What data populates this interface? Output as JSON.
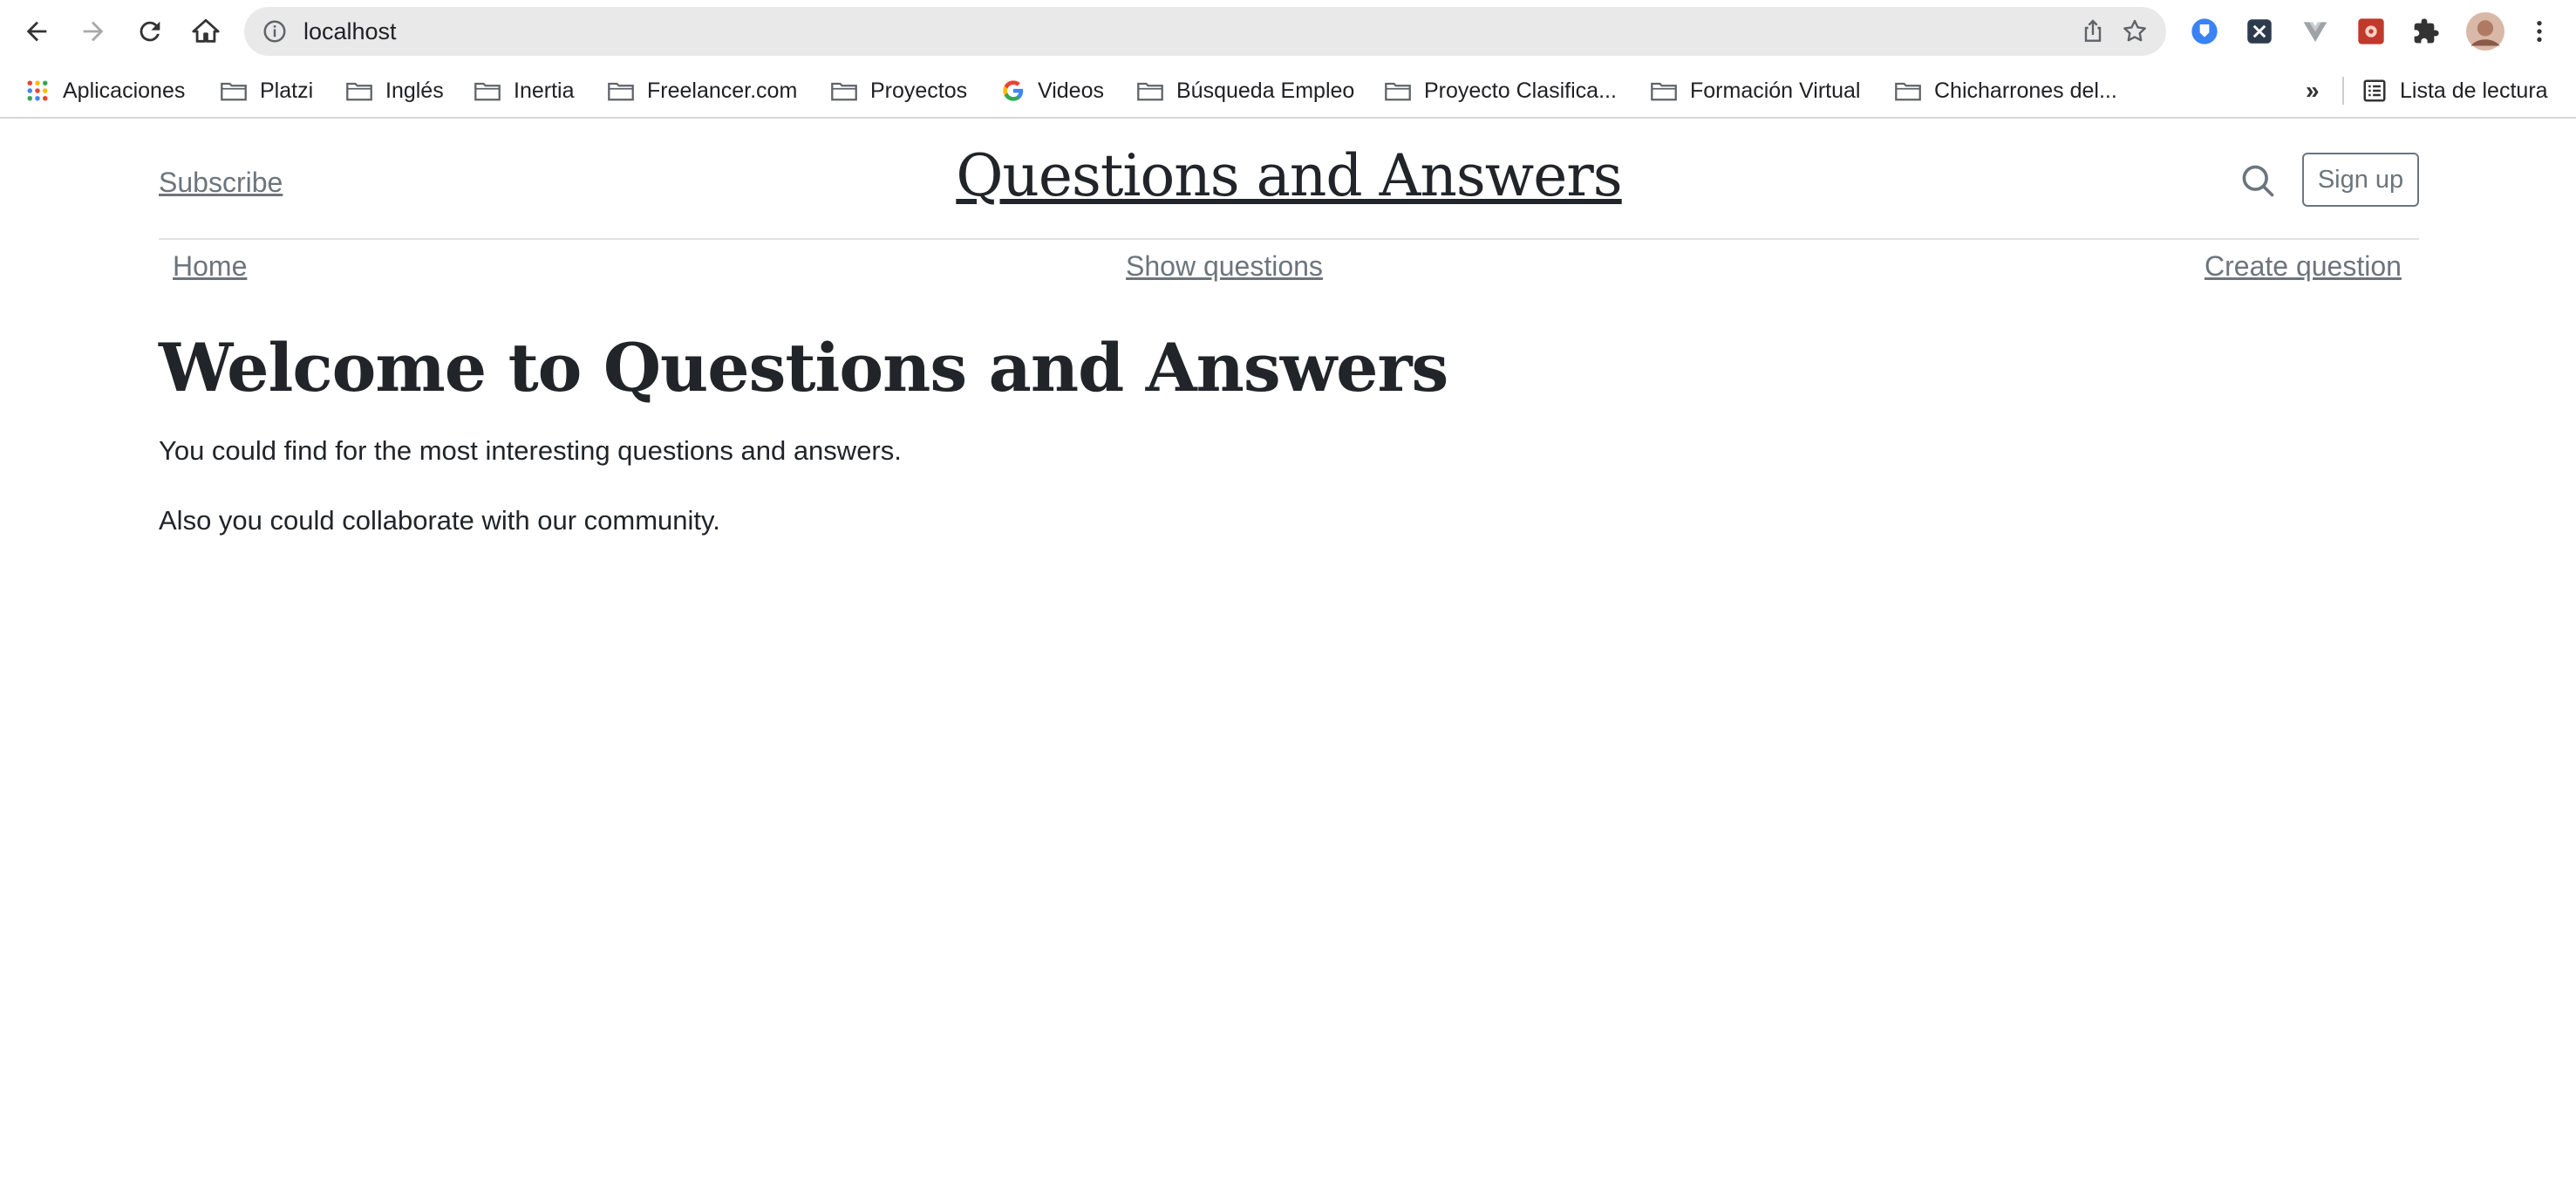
{
  "browser": {
    "url": "localhost",
    "bookmarks": [
      {
        "label": "Aplicaciones",
        "icon": "apps-grid-icon"
      },
      {
        "label": "Platzi",
        "icon": "folder-icon"
      },
      {
        "label": "Inglés",
        "icon": "folder-icon"
      },
      {
        "label": "Inertia",
        "icon": "folder-icon"
      },
      {
        "label": "Freelancer.com",
        "icon": "folder-icon"
      },
      {
        "label": "Proyectos",
        "icon": "folder-icon"
      },
      {
        "label": "Videos",
        "icon": "google-icon"
      },
      {
        "label": "Búsqueda Empleo",
        "icon": "folder-icon"
      },
      {
        "label": "Proyecto Clasifica...",
        "icon": "folder-icon"
      },
      {
        "label": "Formación Virtual",
        "icon": "folder-icon"
      },
      {
        "label": "Chicharrones del...",
        "icon": "folder-icon"
      }
    ],
    "more_bookmarks": "»",
    "reading_list": "Lista de lectura"
  },
  "header": {
    "subscribe": "Subscribe",
    "title": "Questions and Answers",
    "signup": "Sign up"
  },
  "nav": {
    "home": "Home",
    "show_questions": "Show questions",
    "create_question": "Create question"
  },
  "main": {
    "heading": "Welcome to Questions and Answers",
    "lead_1": "You could find for the most interesting questions and answers.",
    "lead_2": "Also you could collaborate with our community."
  },
  "colors": {
    "muted_link": "#6c757d",
    "text": "#212529",
    "omnibox_bg": "#e9e9e9"
  }
}
